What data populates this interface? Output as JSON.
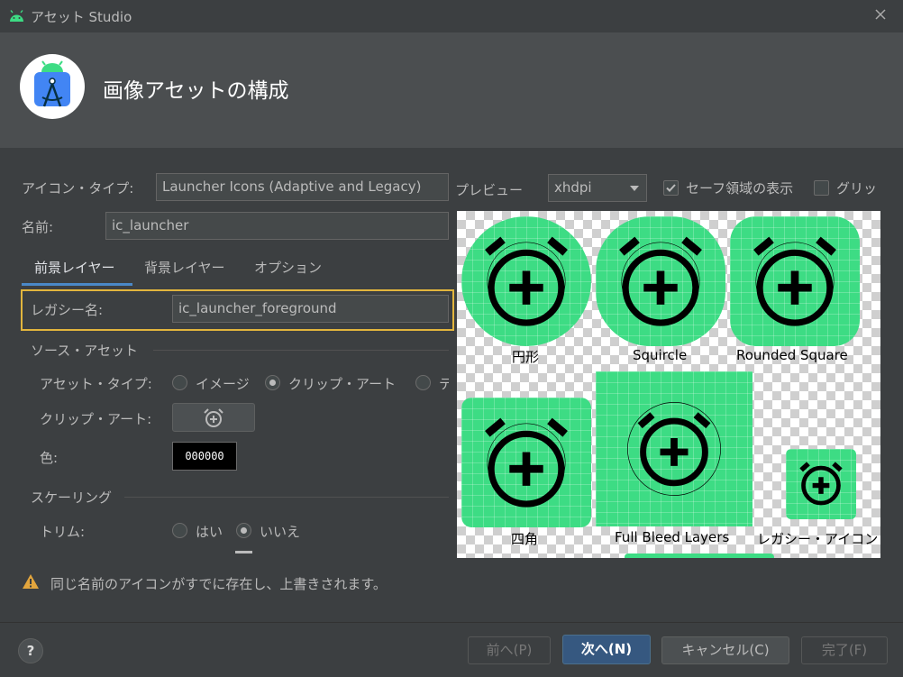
{
  "window": {
    "title": "アセット Studio"
  },
  "banner": {
    "heading": "画像アセットの構成"
  },
  "form": {
    "icon_type_label": "アイコン・タイプ:",
    "icon_type_value": "Launcher Icons (Adaptive and Legacy)",
    "name_label": "名前:",
    "name_value": "ic_launcher",
    "tabs": [
      "前景レイヤー",
      "背景レイヤー",
      "オプション"
    ],
    "legacy_name_label": "レガシー名:",
    "legacy_name_value": "ic_launcher_foreground",
    "source_asset_section": "ソース・アセット",
    "asset_type_label": "アセット・タイプ:",
    "asset_type_options": [
      "イメージ",
      "クリップ・アート",
      "テ"
    ],
    "clip_art_label": "クリップ・アート:",
    "color_label": "色:",
    "color_value": "000000",
    "scaling_section": "スケーリング",
    "trim_label": "トリム:",
    "trim_options": [
      "はい",
      "いいえ"
    ],
    "warning_text": "同じ名前のアイコンがすでに存在し、上書きされます。"
  },
  "preview": {
    "label": "プレビュー",
    "density": "xhdpi",
    "safe_zone_label": "セーフ領域の表示",
    "grid_label": "グリッ",
    "captions": [
      "円形",
      "Squircle",
      "Rounded Square",
      "四角",
      "Full Bleed Layers",
      "レガシー・アイコン"
    ]
  },
  "footer": {
    "help_icon": "?",
    "prev_label": "前へ(P)",
    "next_label": "次へ(N)",
    "cancel_label": "キャンセル(C)",
    "finish_label": "完了(F)"
  },
  "colors": {
    "accent": "#3ddc84",
    "focus": "#e2b53d",
    "tab_underline": "#4a88c7"
  }
}
